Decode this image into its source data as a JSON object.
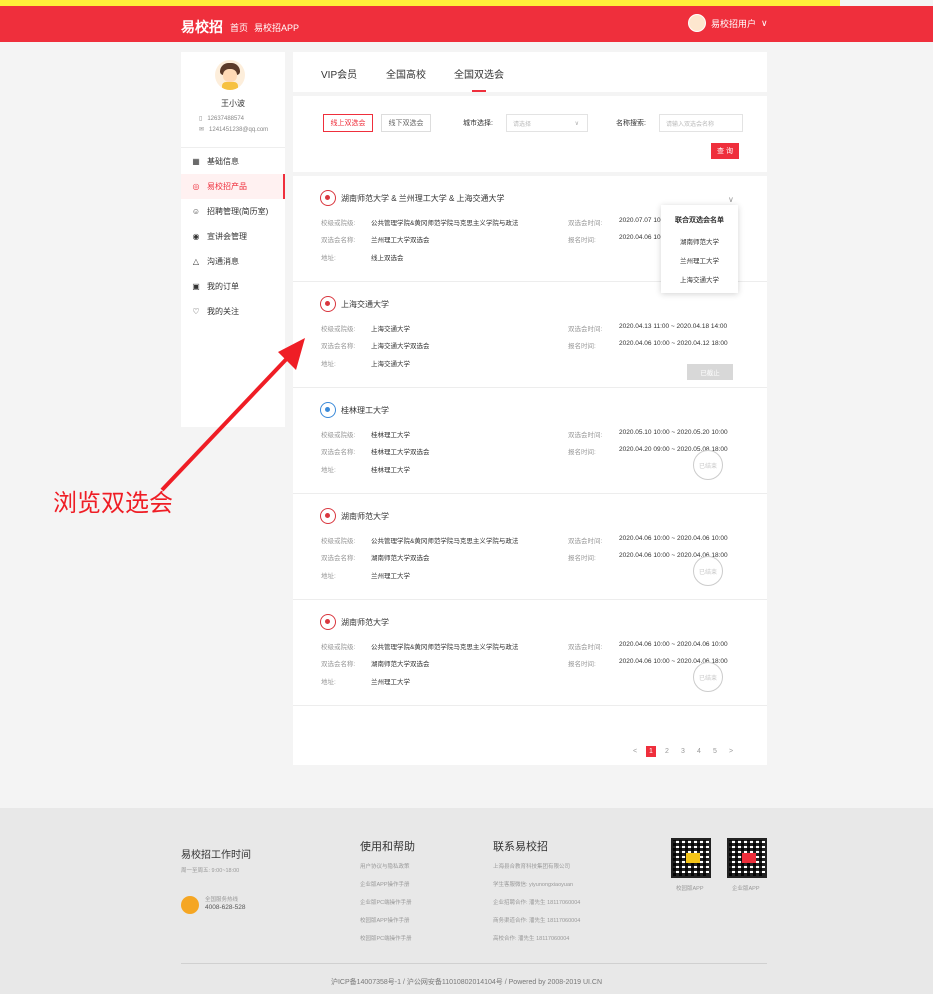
{
  "header": {
    "logo": "易校招",
    "nav": [
      "首页",
      "易校招APP"
    ],
    "username": "易校招用户"
  },
  "profile": {
    "name": "王小波",
    "phone": "12637488574",
    "email": "1241451238@qq.com"
  },
  "sidebar": {
    "items": [
      {
        "label": "基础信息",
        "icon": "grid-icon"
      },
      {
        "label": "易校招产品",
        "icon": "target-icon"
      },
      {
        "label": "招聘管理(简历室)",
        "icon": "person-icon"
      },
      {
        "label": "宣讲会管理",
        "icon": "eye-icon"
      },
      {
        "label": "沟通消息",
        "icon": "bell-icon"
      },
      {
        "label": "我的订单",
        "icon": "order-icon"
      },
      {
        "label": "我的关注",
        "icon": "heart-icon"
      }
    ]
  },
  "tabs": [
    "VIP会员",
    "全国高校",
    "全国双选会"
  ],
  "filters": {
    "online": "线上双选会",
    "offline": "线下双选会",
    "city_label": "城市选择:",
    "city_placeholder": "请选择",
    "name_label": "名称搜索:",
    "name_placeholder": "请输入双选会名称",
    "query": "查 询"
  },
  "labels": {
    "school": "校级或院级:",
    "fair": "双选会名称:",
    "addr": "地址:",
    "time": "双选会时间:",
    "signup": "报名时间:"
  },
  "events": [
    {
      "title": "湖南师范大学 & 兰州理工大学 & 上海交通大学",
      "school": "公共管理学院&黄冈师范学院马克思主义学院与政法",
      "fair": "兰州理工大学双选会",
      "addr": "线上双选会",
      "time": "2020.07.07 10",
      "signup": "2020.04.06 10"
    },
    {
      "title": "上海交通大学",
      "school": "上海交通大学",
      "fair": "上海交通大学双选会",
      "addr": "上海交通大学",
      "time": "2020.04.13 11:00 ~ 2020.04.18 14:00",
      "signup": "2020.04.06 10:00 ~ 2020.04.12 18:00",
      "button": "已截止"
    },
    {
      "title": "桂林理工大学",
      "school": "桂林理工大学",
      "fair": "桂林理工大学双选会",
      "addr": "桂林理工大学",
      "time": "2020.05.10 10:00 ~ 2020.05.20 10:00",
      "signup": "2020.04.20 09:00 ~ 2020.05.08 18:00"
    },
    {
      "title": "湖南师范大学",
      "school": "公共管理学院&黄冈师范学院马克思主义学院与政法",
      "fair": "湖南师范大学双选会",
      "addr": "兰州理工大学",
      "time": "2020.04.06 10:00 ~ 2020.04.06 10:00",
      "signup": "2020.04.06 10:00 ~ 2020.04.06 18:00"
    },
    {
      "title": "湖南师范大学",
      "school": "公共管理学院&黄冈师范学院马克思主义学院与政法",
      "fair": "湖南师范大学双选会",
      "addr": "兰州理工大学",
      "time": "2020.04.06 10:00 ~ 2020.04.06 10:00",
      "signup": "2020.04.06 10:00 ~ 2020.04.06 18:00"
    }
  ],
  "popup": {
    "title": "联合双选会名单",
    "items": [
      "湖南师范大学",
      "兰州理工大学",
      "上海交通大学"
    ]
  },
  "stamp_text": "已结束",
  "pagination": {
    "prev": "<",
    "pages": [
      "1",
      "2",
      "3",
      "4",
      "5"
    ],
    "next": ">",
    "current": "1"
  },
  "callout": "浏览双选会",
  "footer": {
    "hours_title": "易校招工作时间",
    "hours": "周一至周五: 9:00~18:00",
    "hotline_label": "全国服务热线",
    "hotline": "4008-628-528",
    "help_title": "使用和帮助",
    "help_links": [
      "用户协议与隐私政策",
      "企业版APP操作手册",
      "企业版PC端操作手册",
      "校园版APP操作手册",
      "校园版PC端操作手册"
    ],
    "contact_title": "联系易校招",
    "contact_lines": [
      "上海县合教育科技集团有限公司",
      "学生客服微信: yiyunongxiaoyuan",
      "企业招聘合作: 潘先生 18117060004",
      "商务渠道合作: 潘先生 18117060004",
      "高校合作: 潘先生 18117060004"
    ],
    "qr_labels": [
      "校园版APP",
      "企业版APP"
    ],
    "icp": "沪ICP备14007358号-1 / 沪公网安备11010802014104号 / Powered by 2008-2019 UI.CN"
  }
}
